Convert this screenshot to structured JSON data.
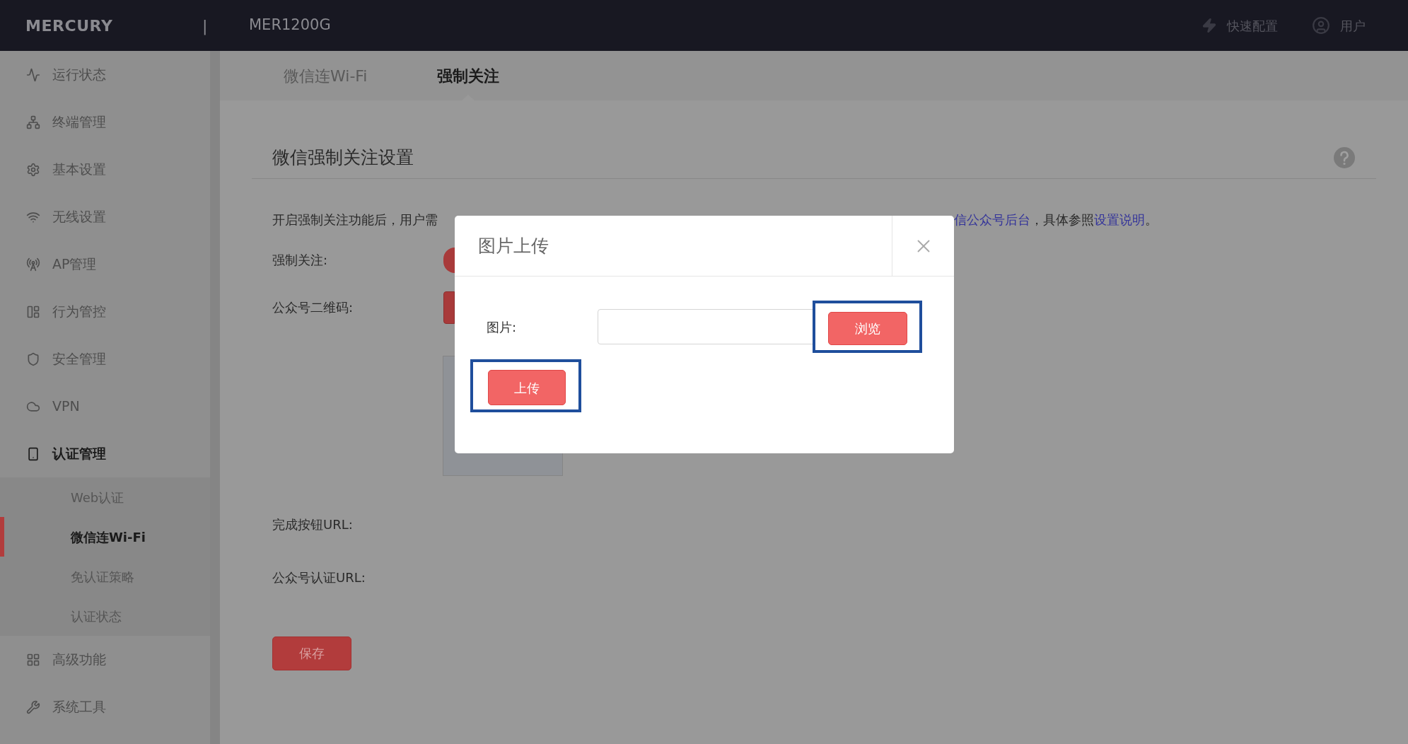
{
  "header": {
    "logo": "MERCURY",
    "separator": "|",
    "model": "MER1200G",
    "actions": [
      {
        "kind": "quick",
        "label": "快速配置"
      },
      {
        "kind": "user",
        "label": "用户"
      }
    ]
  },
  "sidebar": {
    "items": [
      {
        "label": "运行状态",
        "selected": false
      },
      {
        "label": "终端管理",
        "selected": false
      },
      {
        "label": "基本设置",
        "selected": false
      },
      {
        "label": "无线设置",
        "selected": false
      },
      {
        "label": "AP管理",
        "selected": false
      },
      {
        "label": "行为管控",
        "selected": false
      },
      {
        "label": "安全管理",
        "selected": false
      },
      {
        "label": "VPN",
        "selected": false
      },
      {
        "label": "认证管理",
        "selected": true,
        "children": [
          {
            "label": "Web认证",
            "selected": false
          },
          {
            "label": "微信连Wi-Fi",
            "selected": true
          },
          {
            "label": "免认证策略",
            "selected": false
          },
          {
            "label": "认证状态",
            "selected": false
          }
        ]
      },
      {
        "label": "高级功能",
        "selected": false
      },
      {
        "label": "系统工具",
        "selected": false
      }
    ]
  },
  "tabs": [
    {
      "label": "微信连Wi-Fi",
      "selected": false
    },
    {
      "label": "强制关注",
      "selected": true
    }
  ],
  "section": {
    "title": "微信强制关注设置",
    "description": {
      "text_1": "开启强制关注功能后，用户需",
      "link_1": "信公众号后台",
      "text_2": "，具体参照",
      "link_2": "设置说明",
      "text_3": "。"
    },
    "fields": [
      {
        "kind": "toggle",
        "label": "强制关注:",
        "on": true
      },
      {
        "kind": "button",
        "label": "公众号二维码:"
      }
    ],
    "url_fields": [
      "完成按钮URL:",
      "公众号认证URL:"
    ],
    "save_button": "保存"
  },
  "dialog": {
    "title": "图片上传",
    "field_label": "图片:",
    "browse_button": "浏览",
    "upload_button": "上传"
  }
}
